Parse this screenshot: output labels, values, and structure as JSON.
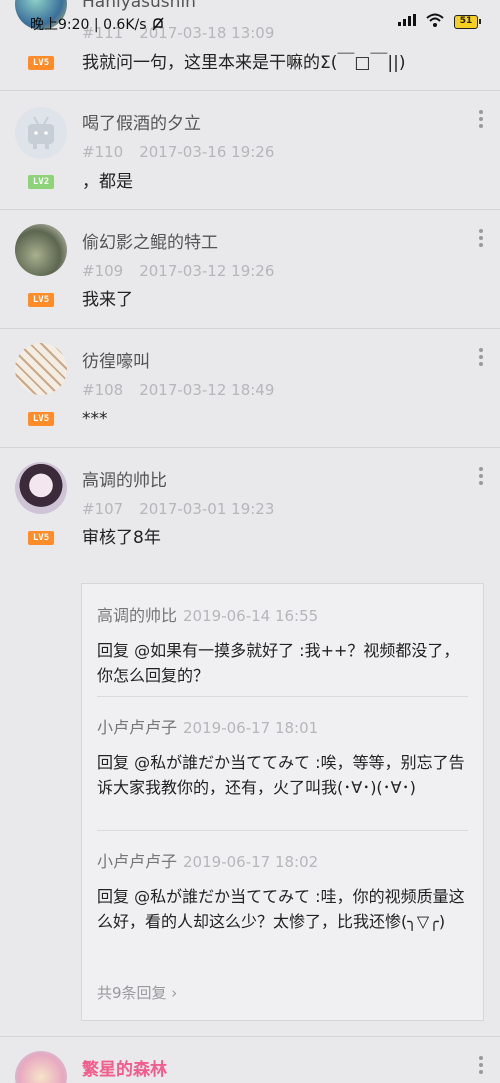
{
  "status": {
    "time": "晚上9:20",
    "speed": "0.6K/s",
    "battery": "51"
  },
  "comments": [
    {
      "name": "Hanlyasushin",
      "floor": "#111",
      "time": "2017-03-18 13:09",
      "level": "LV5",
      "text": "我就问一句，这里本来是干嘛的Σ(￣□￣||)"
    },
    {
      "name": "喝了假酒的夕立",
      "floor": "#110",
      "time": "2017-03-16 19:26",
      "level": "LV2",
      "text": "，都是"
    },
    {
      "name": "偷幻影之鲲的特工",
      "floor": "#109",
      "time": "2017-03-12 19:26",
      "level": "LV5",
      "text": "我来了"
    },
    {
      "name": "彷徨嚎叫",
      "floor": "#108",
      "time": "2017-03-12 18:49",
      "level": "LV5",
      "text": "***"
    },
    {
      "name": "高调的帅比",
      "floor": "#107",
      "time": "2017-03-01 19:23",
      "level": "LV5",
      "text": "审核了8年"
    },
    {
      "name": "繁星的森林"
    }
  ],
  "replies": [
    {
      "name": "高调的帅比",
      "time": "2019-06-14 16:55",
      "text": "回复 @如果有一摸多就好了 :我++？视频都没了，你怎么回复的？"
    },
    {
      "name": "小卢卢卢子",
      "time": "2019-06-17 18:01",
      "text": "回复 @私が誰だか当ててみて :唉，等等，别忘了告诉大家我教你的，还有，火了叫我(･∀･)(･∀･)"
    },
    {
      "name": "小卢卢卢子",
      "time": "2019-06-17 18:02",
      "text": "回复 @私が誰だか当ててみて :哇，你的视频质量这么好，看的人却这么少？太惨了，比我还惨(╮▽╭)"
    }
  ],
  "more_replies": "共9条回复 ›",
  "icons": {
    "signal": "signal-icon",
    "wifi": "wifi-icon",
    "more": "more-vertical-icon",
    "mute": "bell-off-icon"
  }
}
